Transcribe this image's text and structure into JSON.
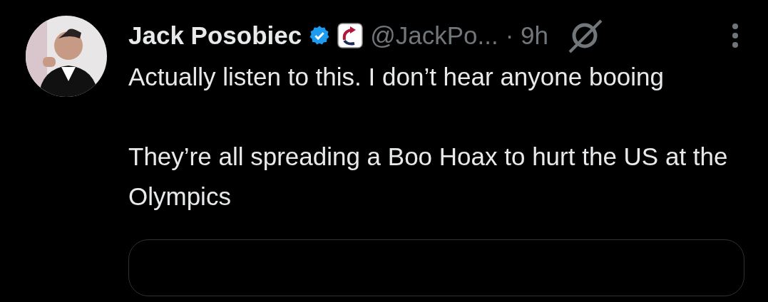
{
  "post": {
    "author": {
      "name": "Jack Posobiec",
      "verified": true,
      "handle": "@JackPo...",
      "time": "· 9h"
    },
    "paragraphs": [
      "Actually listen to this. I don’t hear anyone booing",
      "They’re all spreading a Boo Hoax to hurt the US at the Olympics"
    ],
    "embed": {
      "kind": "card"
    }
  }
}
